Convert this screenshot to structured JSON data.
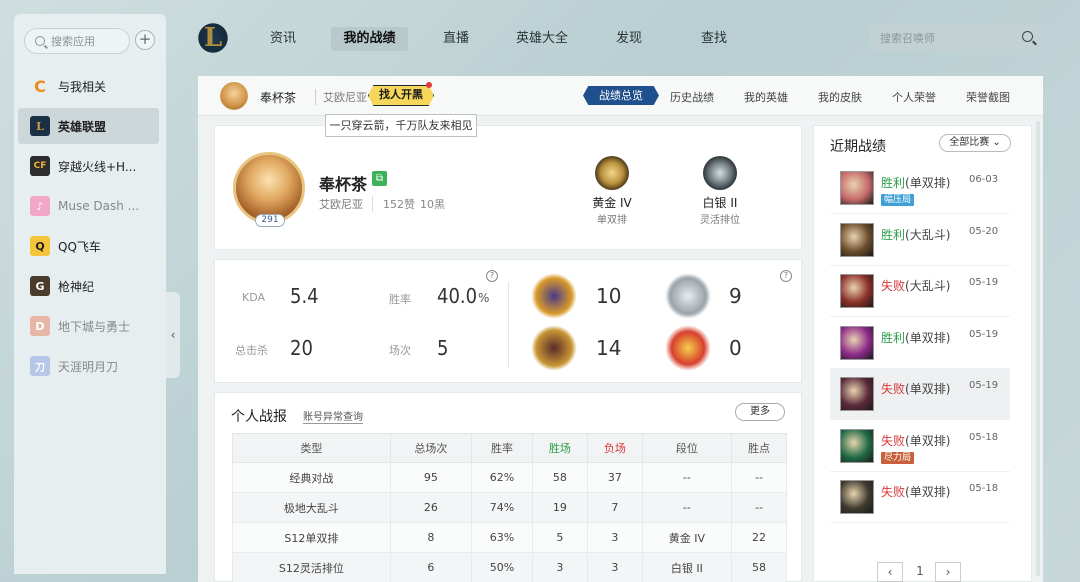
{
  "sidebar": {
    "search_placeholder": "搜索应用",
    "add_label": "+",
    "items": [
      {
        "label": "与我相关",
        "icon": "C",
        "icon_color": "#f08a1c"
      },
      {
        "label": "英雄联盟",
        "icon": "L",
        "icon_color": "#1b2f45"
      },
      {
        "label": "穿越火线+H...",
        "icon": "CF",
        "icon_color": "#2d2d2d"
      },
      {
        "label": "Muse Dash ...",
        "icon": "♪",
        "icon_color": "#f3a7c7"
      },
      {
        "label": "QQ飞车",
        "icon": "Q",
        "icon_color": "#f4c53b"
      },
      {
        "label": "枪神纪",
        "icon": "G",
        "icon_color": "#4b3b2b"
      },
      {
        "label": "地下城与勇士",
        "icon": "D",
        "icon_color": "#e6b7a6"
      },
      {
        "label": "天涯明月刀",
        "icon": "刀",
        "icon_color": "#b7c7e8"
      }
    ],
    "collapse_icon": "‹"
  },
  "nav": {
    "logo": "L",
    "items": [
      "资讯",
      "我的战绩",
      "直播",
      "英雄大全",
      "发现",
      "查找"
    ],
    "search_placeholder": "搜索召唤师"
  },
  "subbar": {
    "name": "奉杯茶",
    "region": "艾欧尼亚",
    "find_team": "找人开黑",
    "tooltip": "一只穿云箭，千万队友来相见",
    "tabs": [
      "战绩总览",
      "历史战绩",
      "我的英雄",
      "我的皮肤",
      "个人荣誉",
      "荣誉截图"
    ]
  },
  "profile": {
    "name": "奉杯茶",
    "level": "291",
    "region": "艾欧尼亚",
    "likes": "152赞",
    "dislikes": "10黑",
    "ranks": [
      {
        "tier": "黄金 IV",
        "mode": "单双排",
        "color": "#b8913e"
      },
      {
        "tier": "白银 II",
        "mode": "灵活排位",
        "color": "#6e7a80"
      }
    ]
  },
  "stats": {
    "kda_label": "KDA",
    "kda": "5.4",
    "winrate_label": "胜率",
    "winrate": "40.0",
    "winrate_unit": "%",
    "kills_label": "总击杀",
    "kills": "20",
    "games_label": "场次",
    "games": "5",
    "badges": [
      {
        "name": "MVP",
        "value": "10",
        "color": "#d99a2b"
      },
      {
        "name": "SVP",
        "value": "9",
        "color": "#9aa3a8"
      },
      {
        "name": "LEGENDARY",
        "value": "14",
        "color": "#c89535"
      },
      {
        "name": "5",
        "value": "0",
        "color": "#d6402e"
      }
    ],
    "help": "?"
  },
  "report": {
    "title": "个人战报",
    "link": "账号异常查询",
    "more": "更多",
    "columns": [
      "类型",
      "总场次",
      "胜率",
      "胜场",
      "负场",
      "段位",
      "胜点"
    ],
    "rows": [
      [
        "经典对战",
        "95",
        "62%",
        "58",
        "37",
        "--",
        "--"
      ],
      [
        "极地大乱斗",
        "26",
        "74%",
        "19",
        "7",
        "--",
        "--"
      ],
      [
        "S12单双排",
        "8",
        "63%",
        "5",
        "3",
        "黄金 IV",
        "22"
      ],
      [
        "S12灵活排位",
        "6",
        "50%",
        "3",
        "3",
        "白银 II",
        "58"
      ]
    ]
  },
  "recent": {
    "title": "近期战绩",
    "filter": "全部比赛",
    "matches": [
      {
        "result": "胜利",
        "mode": "(单双排)",
        "date": "06-03",
        "win": true,
        "tag": "幅压局",
        "tag_color": "#3fa0d8",
        "thumb": "#c66a6a"
      },
      {
        "result": "胜利",
        "mode": "(大乱斗)",
        "date": "05-20",
        "win": true,
        "tag": "",
        "tag_color": "",
        "thumb": "#6b4d2c"
      },
      {
        "result": "失败",
        "mode": "(大乱斗)",
        "date": "05-19",
        "win": false,
        "tag": "",
        "tag_color": "",
        "thumb": "#8a2f2a"
      },
      {
        "result": "胜利",
        "mode": "(单双排)",
        "date": "05-19",
        "win": true,
        "tag": "",
        "tag_color": "",
        "thumb": "#8e2a8a"
      },
      {
        "result": "失败",
        "mode": "(单双排)",
        "date": "05-19",
        "win": false,
        "tag": "",
        "tag_color": "",
        "thumb": "#5a2a3a"
      },
      {
        "result": "失败",
        "mode": "(单双排)",
        "date": "05-18",
        "win": false,
        "tag": "尽力局",
        "tag_color": "#c8603c",
        "thumb": "#1f6b45"
      },
      {
        "result": "失败",
        "mode": "(单双排)",
        "date": "05-18",
        "win": false,
        "tag": "",
        "tag_color": "",
        "thumb": "#3f3b2f"
      }
    ],
    "pager": {
      "prev": "‹",
      "page": "1",
      "next": "›"
    }
  }
}
